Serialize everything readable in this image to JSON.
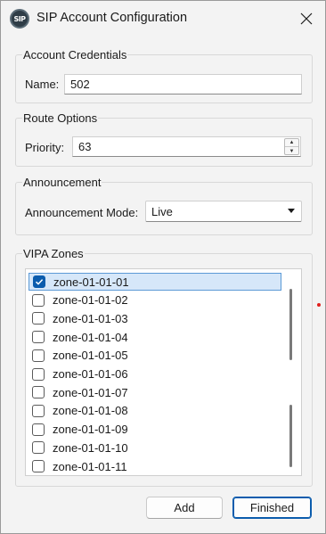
{
  "window": {
    "title": "SIP Account Configuration",
    "app_icon_text": "SIP"
  },
  "credentials": {
    "group_label": "Account Credentials",
    "name_label": "Name:",
    "name_value": "502"
  },
  "route": {
    "group_label": "Route Options",
    "priority_label": "Priority:",
    "priority_value": "63"
  },
  "announcement": {
    "group_label": "Announcement",
    "mode_label": "Announcement Mode:",
    "mode_value": "Live"
  },
  "zones": {
    "group_label": "VIPA Zones",
    "items": [
      {
        "label": "zone-01-01-01",
        "checked": true,
        "selected": true
      },
      {
        "label": "zone-01-01-02",
        "checked": false,
        "selected": false
      },
      {
        "label": "zone-01-01-03",
        "checked": false,
        "selected": false
      },
      {
        "label": "zone-01-01-04",
        "checked": false,
        "selected": false
      },
      {
        "label": "zone-01-01-05",
        "checked": false,
        "selected": false
      },
      {
        "label": "zone-01-01-06",
        "checked": false,
        "selected": false
      },
      {
        "label": "zone-01-01-07",
        "checked": false,
        "selected": false
      },
      {
        "label": "zone-01-01-08",
        "checked": false,
        "selected": false
      },
      {
        "label": "zone-01-01-09",
        "checked": false,
        "selected": false
      },
      {
        "label": "zone-01-01-10",
        "checked": false,
        "selected": false
      },
      {
        "label": "zone-01-01-11",
        "checked": false,
        "selected": false
      }
    ]
  },
  "buttons": {
    "add_label": "Add",
    "finished_label": "Finished"
  },
  "colors": {
    "accent": "#0b5cad",
    "selection": "#d6e7f9",
    "marker": "#e0201d"
  }
}
